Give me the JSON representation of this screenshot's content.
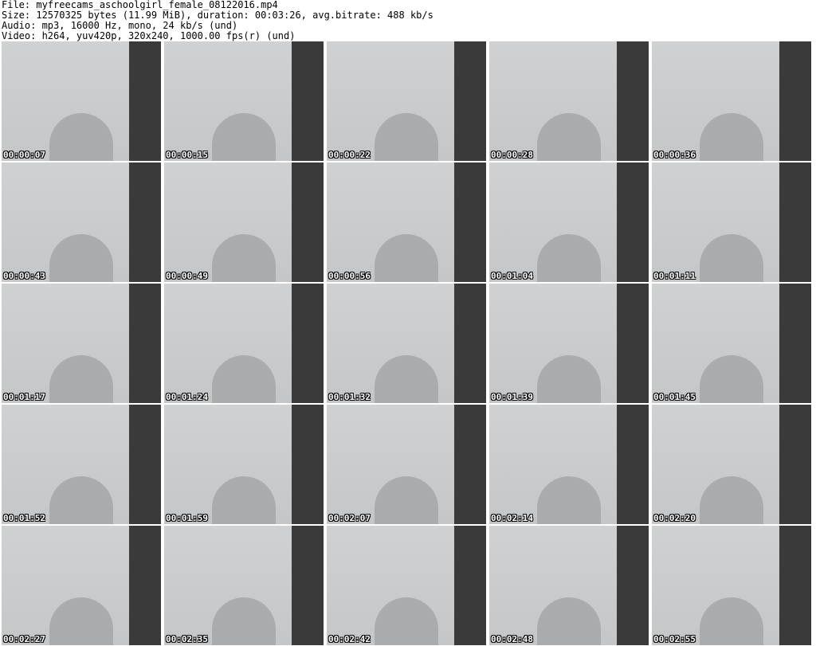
{
  "header": {
    "file_line": "File: myfreecams_aschoolgirl_female_08122016.mp4",
    "size_line": "Size: 12570325 bytes (11.99 MiB), duration: 00:03:26, avg.bitrate: 488 kb/s",
    "audio_line": "Audio: mp3, 16000 Hz, mono, 24 kb/s (und)",
    "video_line": "Video: h264, yuv420p, 320x240, 1000.00 fps(r) (und)"
  },
  "thumbnails": [
    {
      "timestamp": "00:00:07"
    },
    {
      "timestamp": "00:00:15"
    },
    {
      "timestamp": "00:00:22"
    },
    {
      "timestamp": "00:00:28"
    },
    {
      "timestamp": "00:00:36"
    },
    {
      "timestamp": "00:00:43"
    },
    {
      "timestamp": "00:00:49"
    },
    {
      "timestamp": "00:00:56"
    },
    {
      "timestamp": "00:01:04"
    },
    {
      "timestamp": "00:01:11"
    },
    {
      "timestamp": "00:01:17"
    },
    {
      "timestamp": "00:01:24"
    },
    {
      "timestamp": "00:01:32"
    },
    {
      "timestamp": "00:01:39"
    },
    {
      "timestamp": "00:01:45"
    },
    {
      "timestamp": "00:01:52"
    },
    {
      "timestamp": "00:01:59"
    },
    {
      "timestamp": "00:02:07"
    },
    {
      "timestamp": "00:02:14"
    },
    {
      "timestamp": "00:02:20"
    },
    {
      "timestamp": "00:02:27"
    },
    {
      "timestamp": "00:02:35"
    },
    {
      "timestamp": "00:02:42"
    },
    {
      "timestamp": "00:02:48"
    },
    {
      "timestamp": "00:02:55"
    }
  ]
}
